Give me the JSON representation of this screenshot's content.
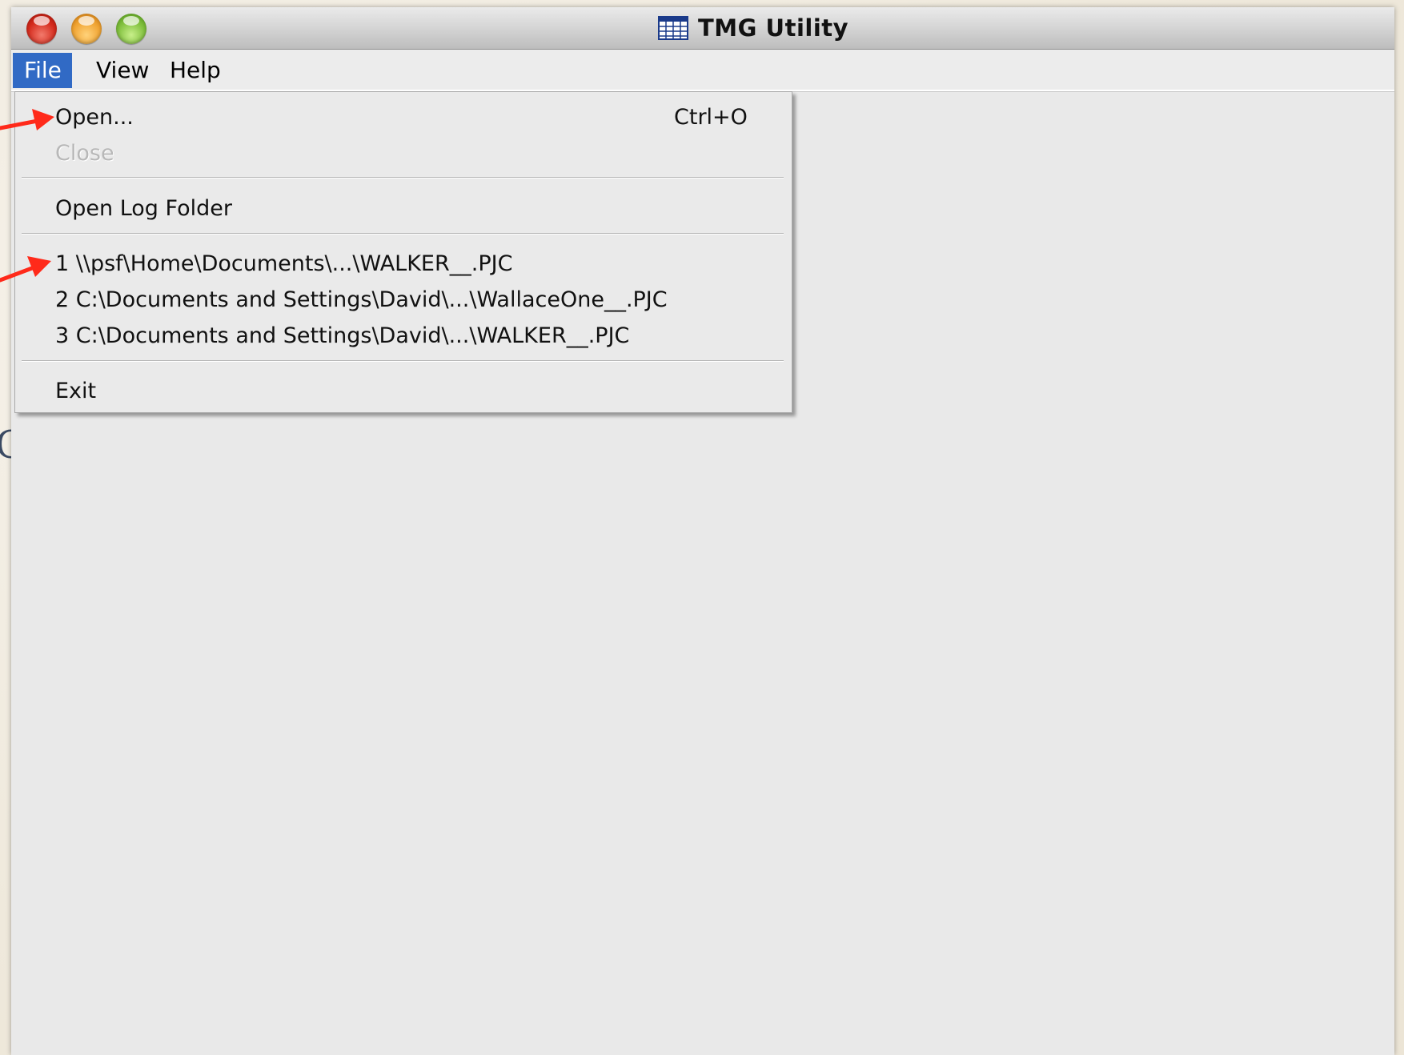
{
  "window": {
    "title": "TMG Utility",
    "app_icon": "table-grid-icon",
    "controls": [
      "close",
      "minimize",
      "zoom"
    ]
  },
  "menubar": {
    "file": "File",
    "view": "View",
    "help": "Help",
    "active_menu": "File"
  },
  "file_menu": {
    "open": {
      "label": "Open...",
      "shortcut": "Ctrl+O"
    },
    "close": {
      "label": "Close",
      "enabled": false
    },
    "open_log_folder": {
      "label": "Open Log Folder"
    },
    "recent": [
      "1 \\\\psf\\Home\\Documents\\...\\WALKER__.PJC",
      "2 C:\\Documents and Settings\\David\\...\\WallaceOne__.PJC",
      "3 C:\\Documents and Settings\\David\\...\\WALKER__.PJC"
    ],
    "exit": {
      "label": "Exit"
    }
  },
  "annotations": {
    "arrow_color": "#ff2a1a",
    "arrow_targets": [
      "open",
      "recent-1"
    ]
  },
  "background_fragment": "G",
  "colors": {
    "menu_highlight": "#316ac5",
    "window_bg": "#e9e9e9"
  }
}
